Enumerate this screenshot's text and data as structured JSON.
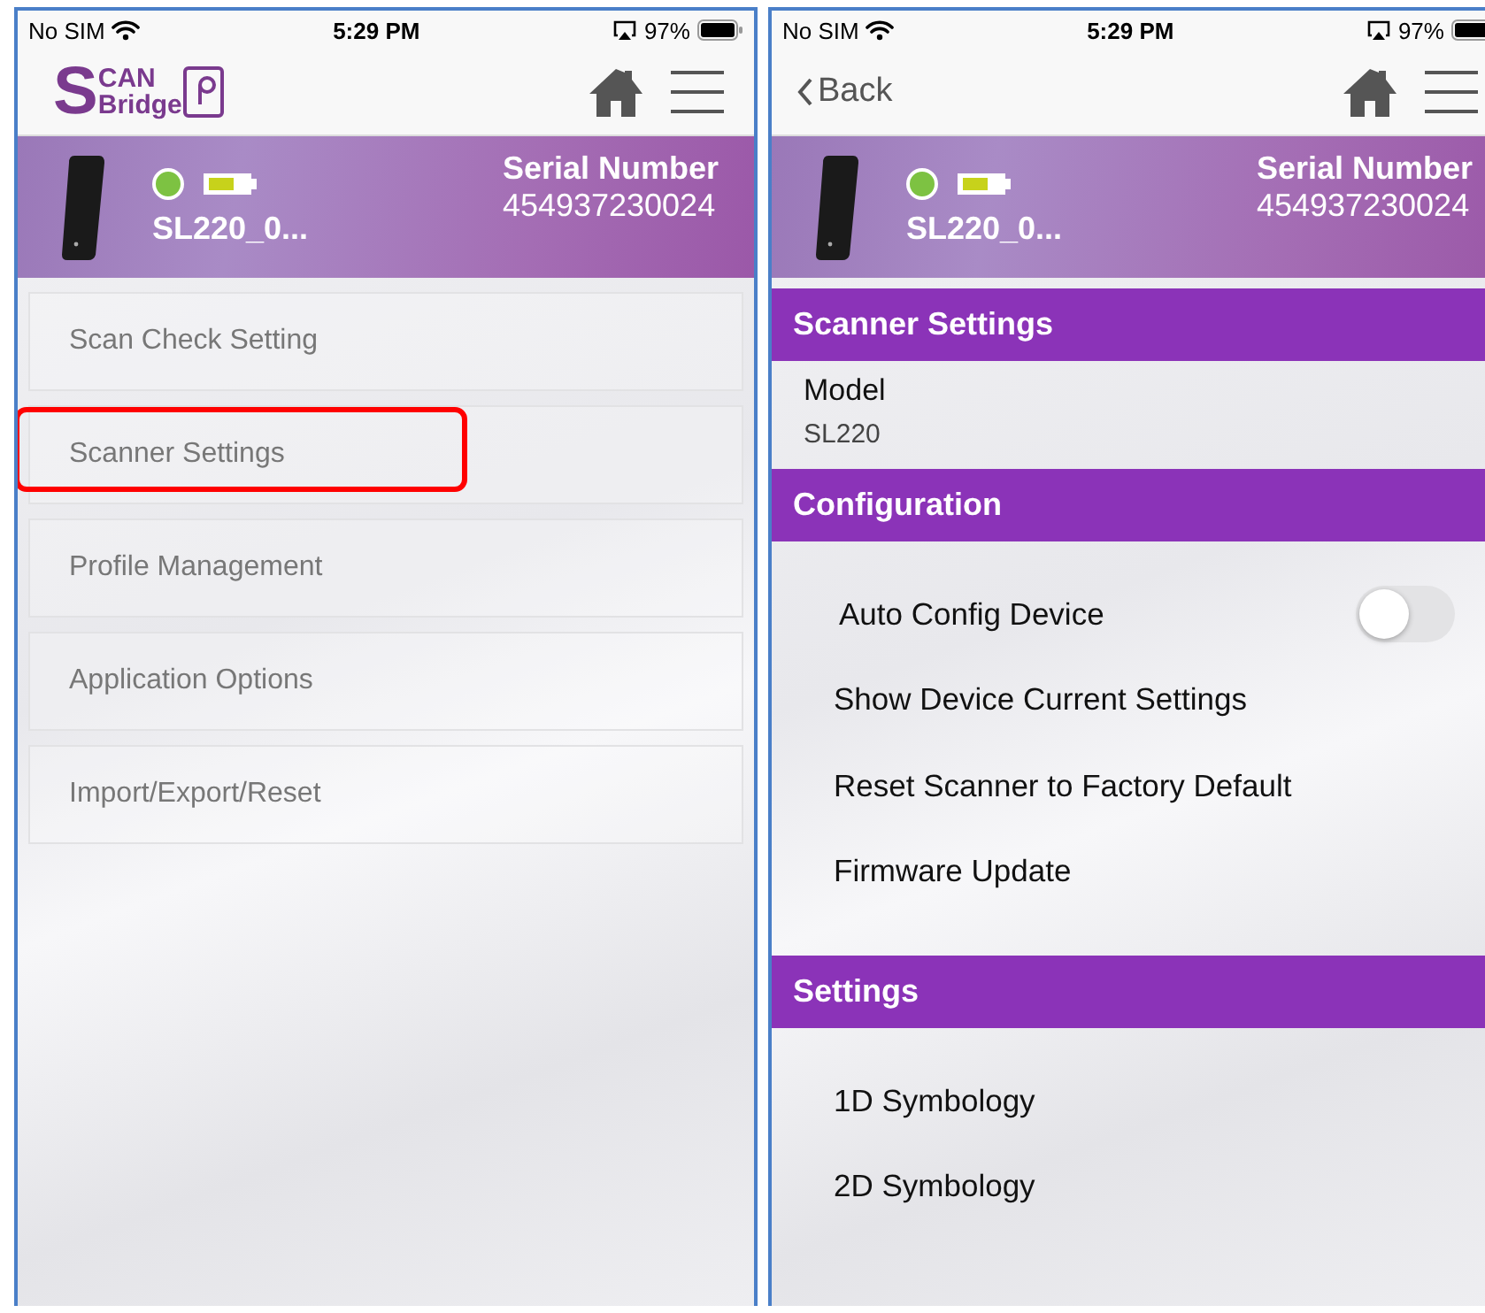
{
  "screens": [
    {
      "status_bar": {
        "carrier": "No SIM",
        "time": "5:29 PM",
        "battery": "97%"
      },
      "nav": {
        "kind": "logo",
        "logo_initial": "S",
        "logo_top": "CAN",
        "logo_bottom": "Bridge"
      },
      "device": {
        "name": "SL220_0...",
        "connected": true,
        "serial_label": "Serial Number",
        "serial_number": "454937230024"
      },
      "menu": [
        {
          "label": "Scan Check Setting",
          "highlighted": false
        },
        {
          "label": "Scanner Settings",
          "highlighted": true
        },
        {
          "label": "Profile Management",
          "highlighted": false
        },
        {
          "label": "Application Options",
          "highlighted": false
        },
        {
          "label": "Import/Export/Reset",
          "highlighted": false
        }
      ]
    },
    {
      "status_bar": {
        "carrier": "No SIM",
        "time": "5:29 PM",
        "battery": "97%"
      },
      "nav": {
        "kind": "back",
        "back_label": "Back"
      },
      "device": {
        "name": "SL220_0...",
        "connected": true,
        "serial_label": "Serial Number",
        "serial_number": "454937230024"
      },
      "sections": [
        {
          "title": "Scanner Settings",
          "rows": [
            {
              "kind": "info",
              "label": "Model",
              "value": "SL220"
            }
          ]
        },
        {
          "title": "Configuration",
          "rows": [
            {
              "kind": "toggle",
              "label": "Auto Config Device",
              "on": false
            },
            {
              "kind": "link",
              "label": "Show Device Current Settings"
            },
            {
              "kind": "link",
              "label": "Reset Scanner to Factory Default"
            },
            {
              "kind": "link",
              "label": "Firmware Update"
            }
          ]
        },
        {
          "title": "Settings",
          "rows": [
            {
              "kind": "link",
              "label": "1D Symbology"
            },
            {
              "kind": "link",
              "label": "2D Symbology"
            }
          ]
        }
      ]
    }
  ]
}
